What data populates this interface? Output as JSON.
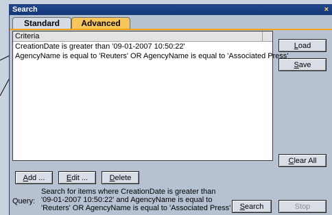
{
  "window": {
    "title": "Search",
    "close": "×"
  },
  "tabs": [
    {
      "label": "Standard"
    },
    {
      "label": "Advanced"
    }
  ],
  "criteria": {
    "header": "Criteria",
    "rows": [
      "CreationDate is greater than '09-01-2007 10:50:22'",
      "AgencyName is equal to 'Reuters' OR AgencyName is equal to 'Associated Press'"
    ]
  },
  "right_buttons": {
    "load": {
      "ul": "L",
      "rest": "oad"
    },
    "save": {
      "ul": "S",
      "rest": "ave"
    },
    "clear_all": {
      "ul": "C",
      "rest": "lear All"
    }
  },
  "bottom_buttons": {
    "add": {
      "ul": "A",
      "rest": "dd ..."
    },
    "edit": {
      "ul": "E",
      "rest": "dit ..."
    },
    "delete": {
      "ul": "D",
      "rest": "elete"
    }
  },
  "query": {
    "label": "Query:",
    "lines": [
      "Search for items where CreationDate is greater than",
      "'09-01-2007 10:50:22' and AgencyName is equal to",
      "'Reuters' OR AgencyName is equal to 'Associated Press'"
    ]
  },
  "actions": {
    "search": {
      "ul": "S",
      "rest": "earch"
    },
    "stop": {
      "ul": "",
      "rest": "Stop"
    }
  }
}
